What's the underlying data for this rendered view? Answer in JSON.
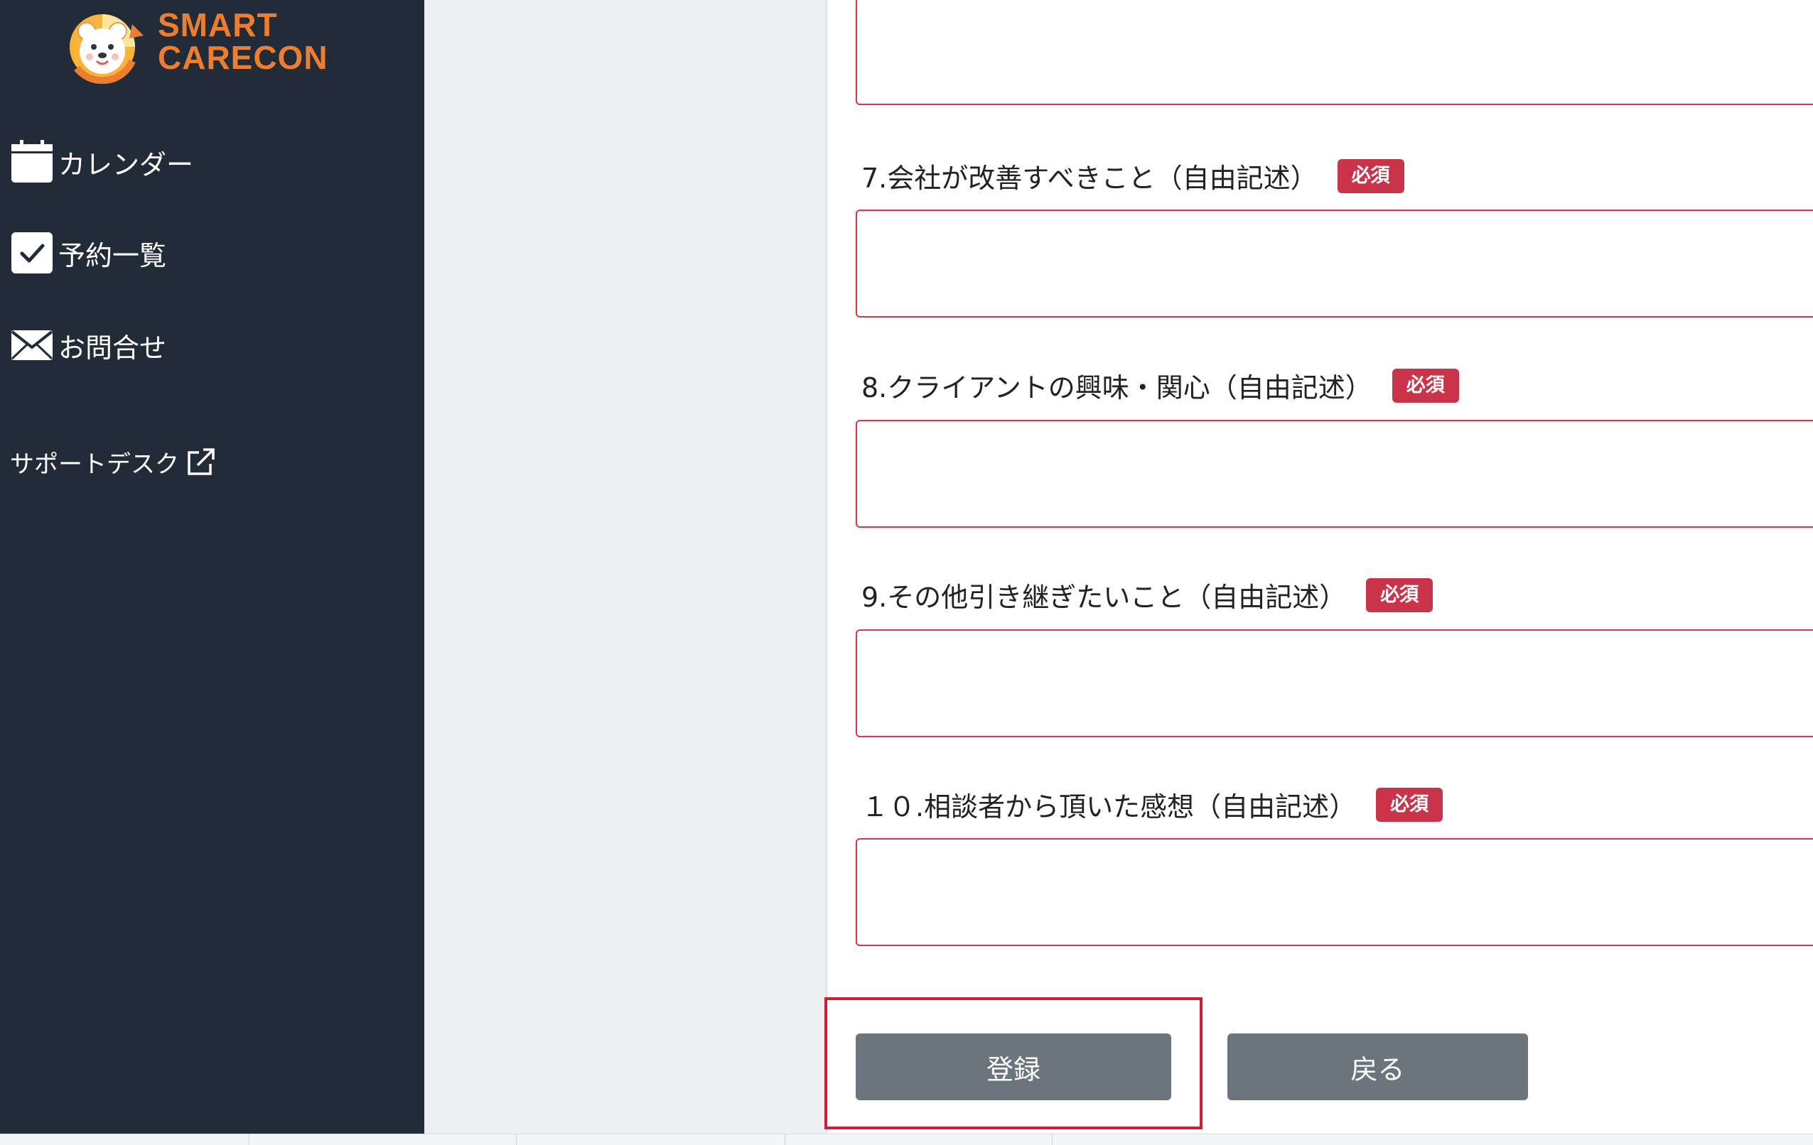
{
  "brand": {
    "line1": "SMART",
    "line2": "CARECON",
    "color": "#ed7d31"
  },
  "sidebar": {
    "items": [
      {
        "label": "カレンダー",
        "icon": "calendar-icon"
      },
      {
        "label": "予約一覧",
        "icon": "checkbox-icon"
      },
      {
        "label": "お問合せ",
        "icon": "mail-icon"
      }
    ],
    "support": {
      "label": "サポートデスク",
      "icon": "external-link-icon"
    }
  },
  "form": {
    "required_badge": "必須",
    "questions": [
      {
        "label": "7.会社が改善すべきこと（自由記述）",
        "value": ""
      },
      {
        "label": "8.クライアントの興味・関心（自由記述）",
        "value": ""
      },
      {
        "label": "9.その他引き継ぎたいこと（自由記述）",
        "value": ""
      },
      {
        "label": "１０.相談者から頂いた感想（自由記述）",
        "value": ""
      }
    ]
  },
  "actions": {
    "submit": "登録",
    "back": "戻る"
  },
  "colors": {
    "sidebar_bg": "#222b38",
    "required_red": "#c9344a",
    "button_gray": "#6c757d"
  }
}
